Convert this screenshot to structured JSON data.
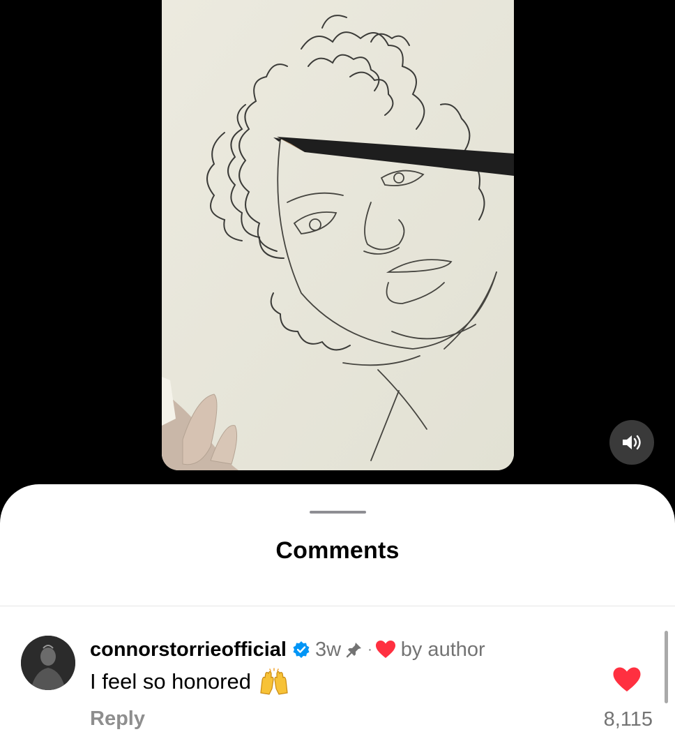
{
  "video": {
    "subject": "pencil-drawing-portrait-video",
    "sound_state": "on"
  },
  "sheet": {
    "title": "Comments"
  },
  "comment": {
    "username": "connorstorrieofficial",
    "verified": true,
    "time": "3w",
    "pinned": true,
    "separator": "·",
    "liked_by_author": true,
    "by_author_label": "by author",
    "text": "I feel so honored",
    "emoji": "raising-hands",
    "reply_label": "Reply",
    "like_count": "8,115",
    "liked": true
  },
  "colors": {
    "background": "#000000",
    "sheet": "#ffffff",
    "heart": "#ff3040",
    "verified": "#0095f6",
    "muted_text": "#737373"
  }
}
